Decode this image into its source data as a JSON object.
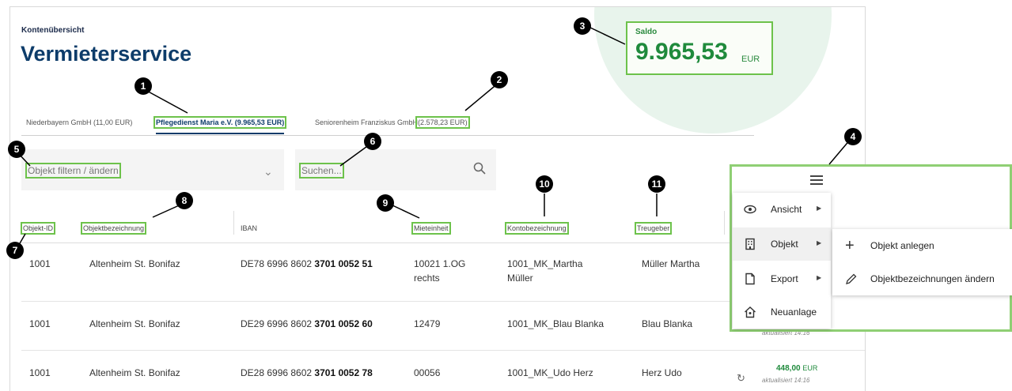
{
  "header": {
    "breadcrumb": "Kontenübersicht",
    "title": "Vermieterservice"
  },
  "saldo": {
    "label": "Saldo",
    "value": "9.965,53",
    "currency": "EUR"
  },
  "tabs": [
    {
      "label": "Niederbayern GmbH (11,00 EUR)"
    },
    {
      "label": "Pflegedienst Maria e.V. (9.965,53 EUR)",
      "active": true
    },
    {
      "label_name": "Seniorenheim Franziskus GmbH",
      "label_amount": "(2.578,23 EUR)"
    }
  ],
  "filter": {
    "placeholder": "Objekt filtern / ändern"
  },
  "search": {
    "placeholder": "Suchen..."
  },
  "table": {
    "headers": [
      "Objekt-ID",
      "Objektbezeichnung",
      "IBAN",
      "Mieteinheit",
      "Kontobezeichnung",
      "Treugeber"
    ],
    "rows": [
      {
        "id": "1001",
        "name": "Altenheim St. Bonifaz",
        "iban_prefix": "DE78 6996 8602",
        "iban_bold": "3701 0052 51",
        "unit_line1": "10021 1.OG",
        "unit_line2": "rechts",
        "konto_line1": "1001_MK_Martha",
        "konto_line2": "Müller",
        "treugeber": "Müller Martha"
      },
      {
        "id": "1001",
        "name": "Altenheim St. Bonifaz",
        "iban_prefix": "DE29 6996 8602",
        "iban_bold": "3701 0052 60",
        "unit_line1": "12479",
        "unit_line2": "",
        "konto_line1": "1001_MK_Blau Blanka",
        "konto_line2": "",
        "treugeber": "Blau Blanka",
        "updated": "aktualisiert 14:16"
      },
      {
        "id": "1001",
        "name": "Altenheim St. Bonifaz",
        "iban_prefix": "DE28 6996 8602",
        "iban_bold": "3701 0052 78",
        "unit_line1": "00056",
        "unit_line2": "",
        "konto_line1": "1001_MK_Udo Herz",
        "konto_line2": "",
        "treugeber": "Herz Udo",
        "amount": "448,00",
        "currency": "EUR",
        "updated": "aktualisiert 14:16"
      }
    ]
  },
  "menu": {
    "items": [
      {
        "label": "Ansicht",
        "icon": "eye-icon"
      },
      {
        "label": "Objekt",
        "icon": "building-icon"
      },
      {
        "label": "Export",
        "icon": "document-icon"
      },
      {
        "label": "Neuanlage",
        "icon": "house-user-icon"
      }
    ],
    "submenu": [
      {
        "label": "Objekt anlegen",
        "icon": "plus-icon"
      },
      {
        "label": "Objektbezeichnungen ändern",
        "icon": "pencil-icon"
      }
    ]
  },
  "callouts": [
    "1",
    "2",
    "3",
    "4",
    "5",
    "6",
    "7",
    "8",
    "9",
    "10",
    "11"
  ]
}
